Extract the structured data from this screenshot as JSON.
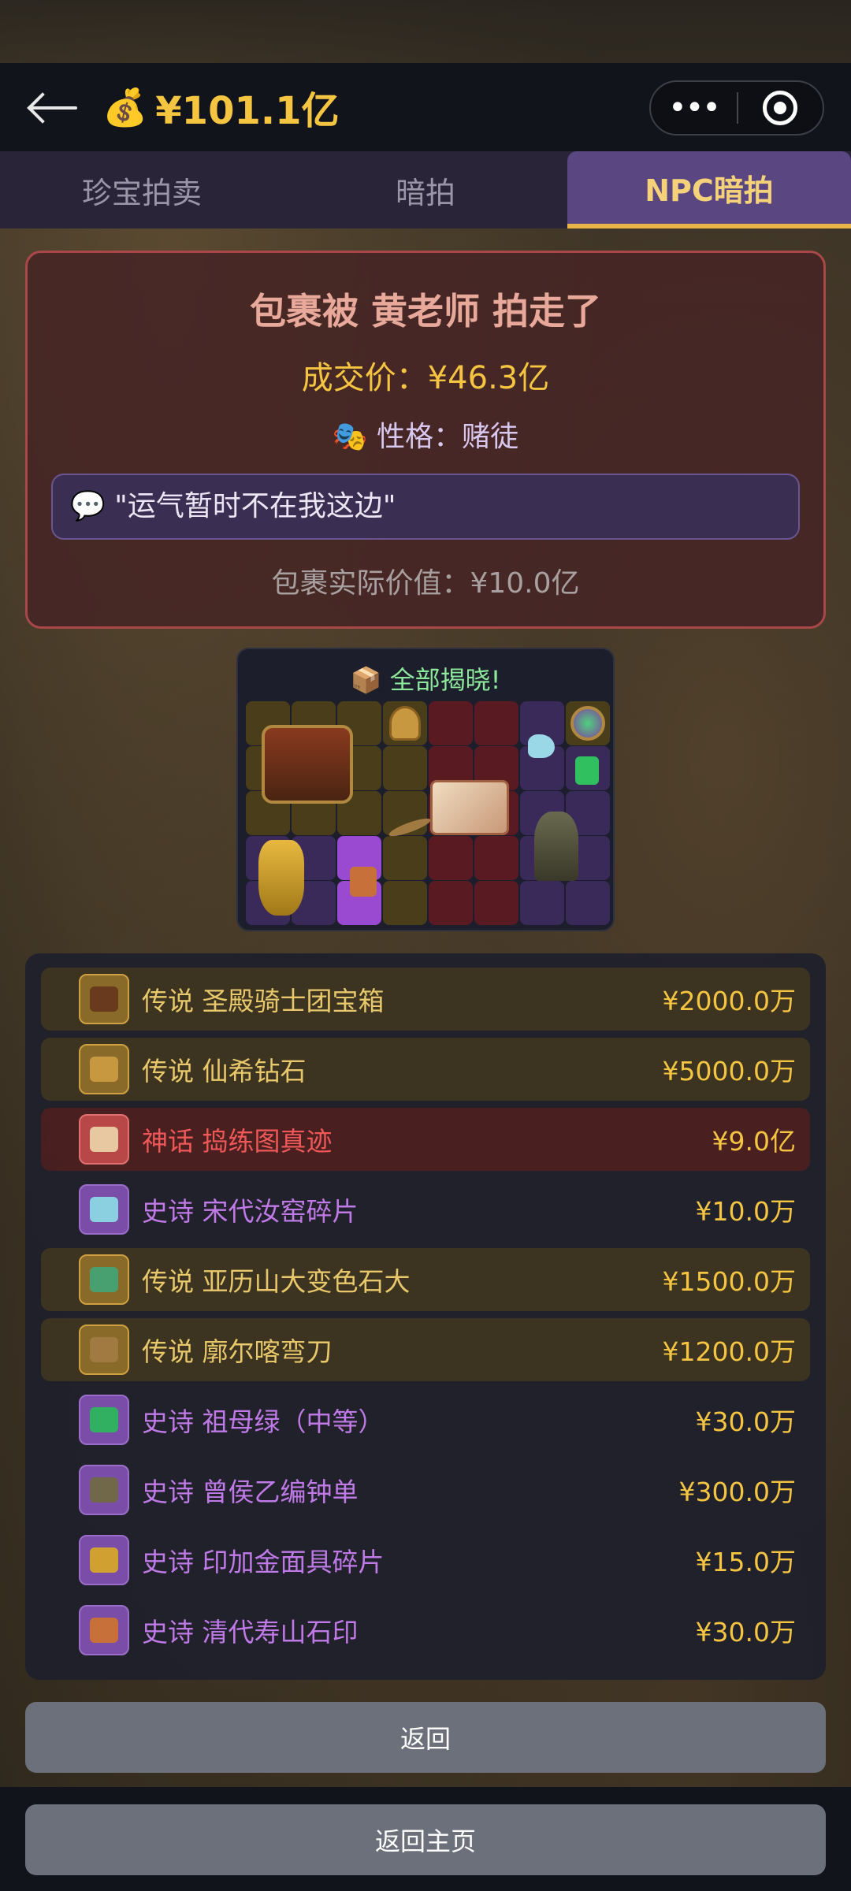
{
  "header": {
    "money_icon": "money-bag-icon",
    "balance": "¥101.1亿"
  },
  "tabs": [
    {
      "label": "珍宝拍卖",
      "active": false
    },
    {
      "label": "暗拍",
      "active": false
    },
    {
      "label": "NPC暗拍",
      "active": true
    }
  ],
  "result": {
    "title": "包裹被 黄老师 拍走了",
    "price": "成交价：¥46.3亿",
    "persona": "🎭 性格：赌徒",
    "quote": "💬 \"运气暂时不在我这边\"",
    "actual_value": "包裹实际价值：¥10.0亿"
  },
  "grid": {
    "title": "📦 全部揭晓!"
  },
  "items": [
    {
      "name": "传说 圣殿骑士团宝箱",
      "price": "¥2000.0万",
      "rarity": "leg",
      "color": "#6a3a1e"
    },
    {
      "name": "传说 仙希钻石",
      "price": "¥5000.0万",
      "rarity": "leg",
      "color": "#c89840"
    },
    {
      "name": "神话 捣练图真迹",
      "price": "¥9.0亿",
      "rarity": "myth",
      "color": "#e8c8a0"
    },
    {
      "name": "史诗 宋代汝窑碎片",
      "price": "¥10.0万",
      "rarity": "epic",
      "color": "#8ad0e0"
    },
    {
      "name": "传说 亚历山大变色石大",
      "price": "¥1500.0万",
      "rarity": "leg",
      "color": "#48a070"
    },
    {
      "name": "传说 廓尔喀弯刀",
      "price": "¥1200.0万",
      "rarity": "leg",
      "color": "#a07a40"
    },
    {
      "name": "史诗 祖母绿（中等）",
      "price": "¥30.0万",
      "rarity": "epic",
      "color": "#30b060"
    },
    {
      "name": "史诗 曾侯乙编钟单",
      "price": "¥300.0万",
      "rarity": "epic",
      "color": "#706848"
    },
    {
      "name": "史诗 印加金面具碎片",
      "price": "¥15.0万",
      "rarity": "epic",
      "color": "#d0a030"
    },
    {
      "name": "史诗 清代寿山石印",
      "price": "¥30.0万",
      "rarity": "epic",
      "color": "#c8703a"
    }
  ],
  "buttons": {
    "back": "返回",
    "home": "返回主页"
  }
}
